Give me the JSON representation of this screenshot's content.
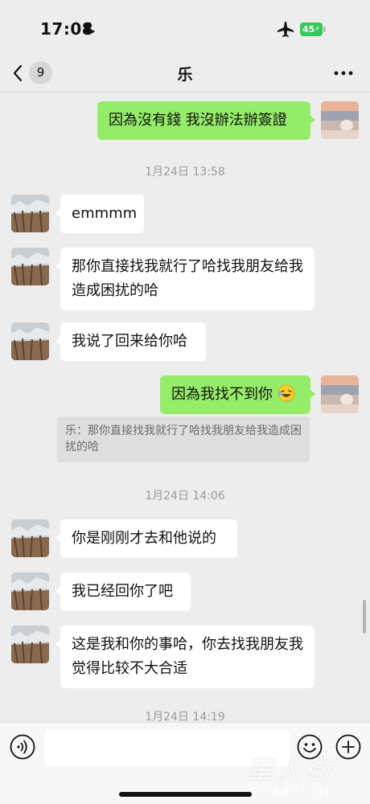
{
  "status_bar": {
    "time": "17:08",
    "battery": "45"
  },
  "nav": {
    "unread_count": "9",
    "title": "乐"
  },
  "messages": [
    {
      "side": "out",
      "text": "因為沒有錢 我沒辦法辦簽證"
    },
    {
      "side": "in",
      "text": "emmmm"
    },
    {
      "side": "in",
      "text": "那你直接找我就行了哈找我朋友给我造成困扰的哈"
    },
    {
      "side": "in",
      "text": "我说了回来给你哈"
    },
    {
      "side": "out",
      "text": "因為我找不到你"
    },
    {
      "side": "in",
      "text": "你是刚刚才去和他说的"
    },
    {
      "side": "in",
      "text": "我已经回你了吧"
    },
    {
      "side": "in",
      "text": "这是我和你的事哈，你去找我朋友我觉得比较不大合适"
    }
  ],
  "timestamps": [
    "1月24日 13:58",
    "1月24日 14:06",
    "1月24日 14:19"
  ],
  "quote": {
    "text": "乐：那你直接找我就行了哈找我朋友给我造成困扰的哈"
  },
  "watermark": {
    "cn": "華人街",
    "en": "HUARENJIE"
  },
  "colors": {
    "outgoing_bubble": "#95ec69",
    "incoming_bubble": "#ffffff",
    "background": "#ededed"
  }
}
